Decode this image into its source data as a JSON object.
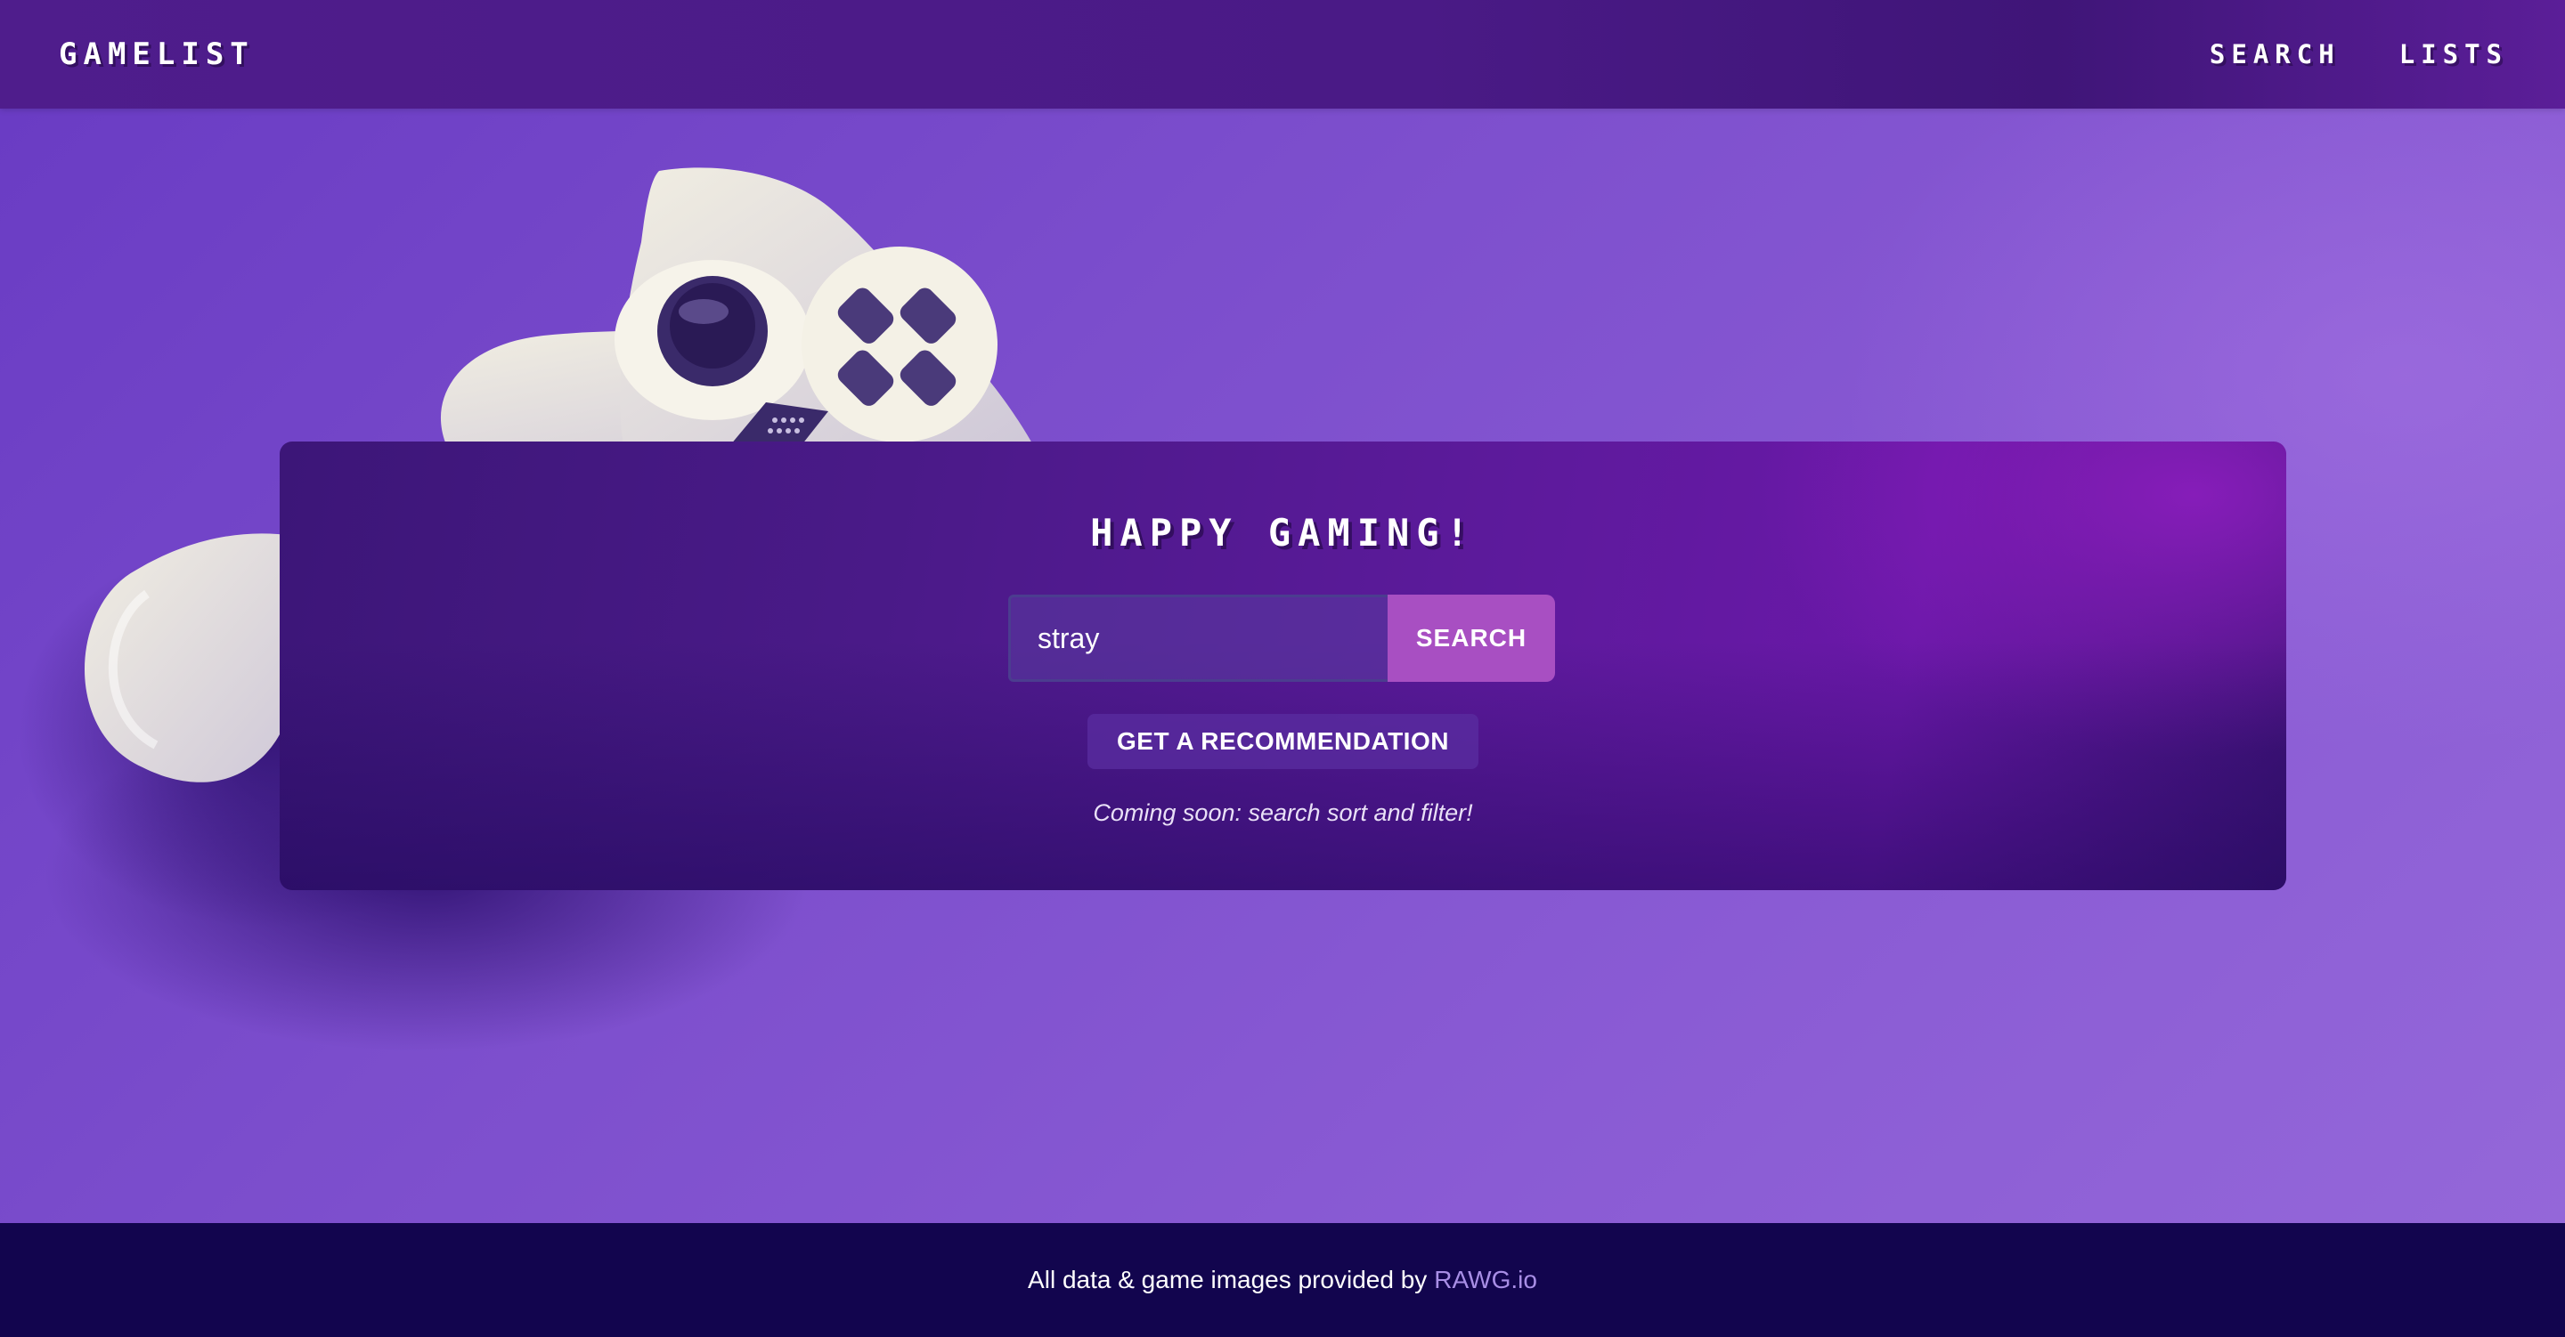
{
  "header": {
    "logo": "GAMELIST",
    "nav": [
      {
        "label": "SEARCH"
      },
      {
        "label": "LISTS"
      }
    ]
  },
  "hero": {
    "title": "HAPPY GAMING!",
    "search": {
      "value": "stray",
      "button_label": "SEARCH"
    },
    "recommendation_label": "GET A RECOMMENDATION",
    "note": "Coming soon: search sort and filter!"
  },
  "footer": {
    "text": "All data & game images provided by",
    "link_text": "RAWG.io"
  },
  "colors": {
    "header": "#4f1d8c",
    "footer": "#12054e",
    "search_button": "#a84fc2",
    "link": "#a88ee6"
  }
}
